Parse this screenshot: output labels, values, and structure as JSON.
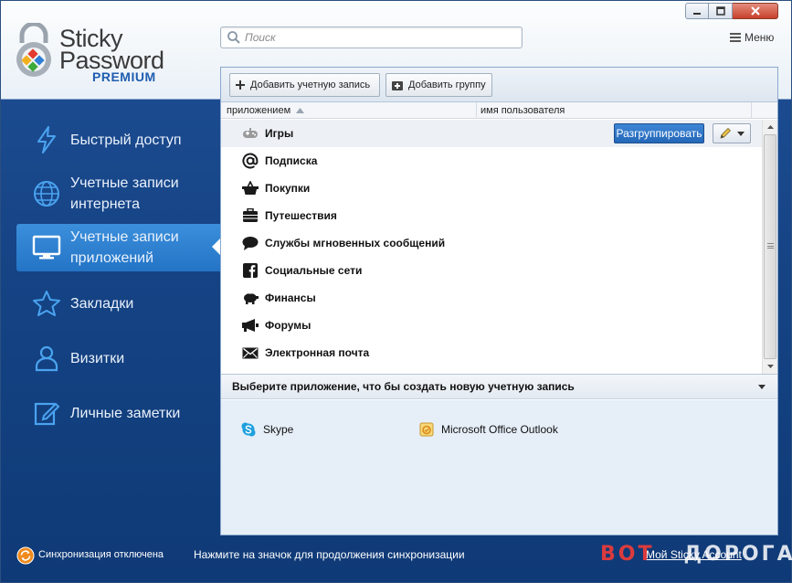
{
  "app": {
    "logo": {
      "line1": "Sticky",
      "line2": "Password",
      "edition": "PREMIUM"
    },
    "window_controls": [
      "minimize",
      "maximize",
      "close"
    ]
  },
  "header": {
    "search": {
      "placeholder": "Поиск",
      "value": ""
    },
    "menu_label": "Меню"
  },
  "sidebar": {
    "active_index": 2,
    "items": [
      {
        "label": "Быстрый доступ",
        "icon": "lightning-icon"
      },
      {
        "label": "Учетные записи\nинтернета",
        "icon": "globe-icon"
      },
      {
        "label": "Учетные записи\nприложений",
        "icon": "monitor-icon"
      },
      {
        "label": "Закладки",
        "icon": "star-icon"
      },
      {
        "label": "Визитки",
        "icon": "person-icon"
      },
      {
        "label": "Личные заметки",
        "icon": "note-icon"
      }
    ]
  },
  "toolbar": {
    "add_account": "Добавить учетную запись",
    "add_group": "Добавить группу"
  },
  "table": {
    "columns": [
      "приложением",
      "имя пользователя"
    ],
    "sort_column": 0,
    "sort_direction": "asc",
    "selected_index": 0,
    "ungroup_label": "Разгруппировать",
    "rows": [
      {
        "label": "Игры",
        "icon": "gamepad-icon"
      },
      {
        "label": "Подписка",
        "icon": "at-icon"
      },
      {
        "label": "Покупки",
        "icon": "basket-icon"
      },
      {
        "label": "Путешествия",
        "icon": "suitcase-icon"
      },
      {
        "label": "Службы мгновенных сообщений",
        "icon": "chat-icon"
      },
      {
        "label": "Социальные сети",
        "icon": "facebook-icon"
      },
      {
        "label": "Финансы",
        "icon": "piggy-bank-icon"
      },
      {
        "label": "Форумы",
        "icon": "megaphone-icon"
      },
      {
        "label": "Электронная почта",
        "icon": "envelope-icon"
      }
    ]
  },
  "apps_panel": {
    "title": "Выберите приложение, что бы создать новую учетную запись",
    "apps": [
      {
        "label": "Skype",
        "icon": "skype-icon"
      },
      {
        "label": "Microsoft Office Outlook",
        "icon": "outlook-icon"
      }
    ]
  },
  "footer": {
    "sync_status": "Синхронизация отключена",
    "sync_hint": "Нажмите на значок для продолжения синхронизации",
    "my_account": "Мой Sticky Account",
    "watermark_red": "BOT",
    "watermark_white": "ДОРОГА"
  },
  "colors": {
    "sidebar_bg": "#154384",
    "active_item": "#2f83d2",
    "ungroup_button": "#2f78cc",
    "watermark_red": "#ff3c32"
  }
}
